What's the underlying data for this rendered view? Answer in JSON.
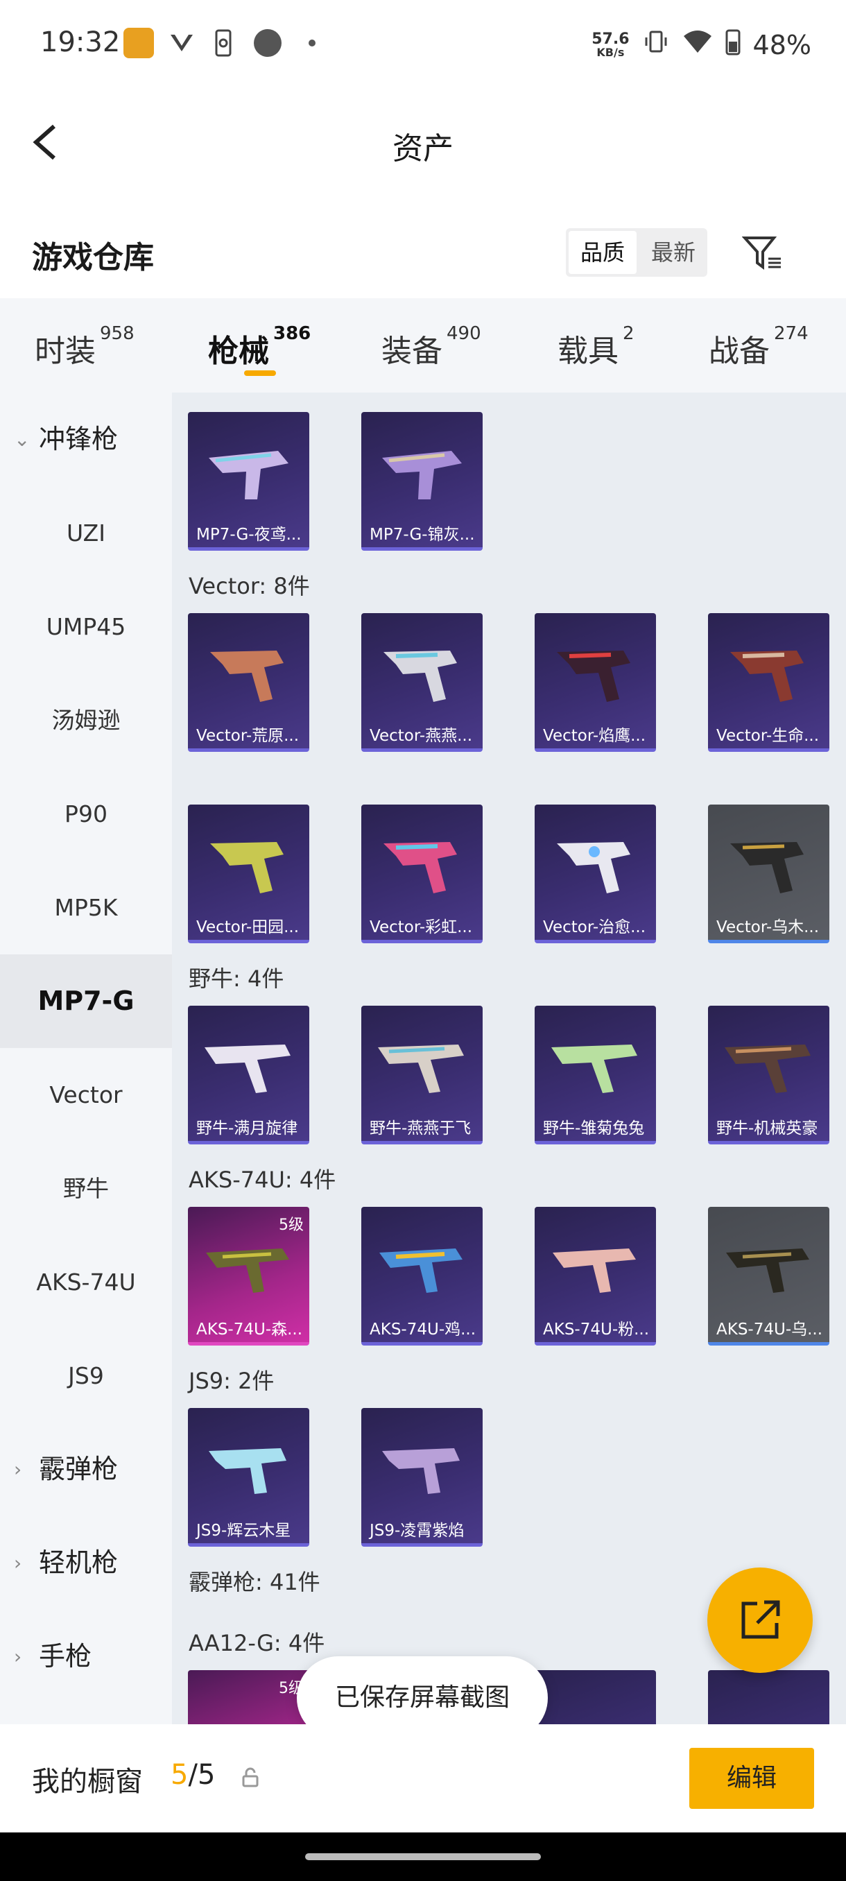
{
  "status": {
    "time": "19:32",
    "speed_value": "57.6",
    "speed_unit": "KB/s",
    "battery": "48%"
  },
  "header": {
    "title": "资产"
  },
  "section": {
    "title": "游戏仓库",
    "sort_quality": "品质",
    "sort_latest": "最新"
  },
  "tabs": [
    {
      "label": "时装",
      "count": "958"
    },
    {
      "label": "枪械",
      "count": "386"
    },
    {
      "label": "装备",
      "count": "490"
    },
    {
      "label": "载具",
      "count": "2"
    },
    {
      "label": "战备",
      "count": "274"
    }
  ],
  "sidebar": {
    "category1": "冲锋枪",
    "items": [
      "UZI",
      "UMP45",
      "汤姆逊",
      "P90",
      "MP5K",
      "MP7-G",
      "Vector",
      "野牛",
      "AKS-74U",
      "JS9"
    ],
    "category2": "霰弹枪",
    "category3": "轻机枪",
    "category4": "手枪"
  },
  "groups": {
    "mp7": {
      "cards": [
        "MP7-G-夜鸢...",
        "MP7-G-锦灰..."
      ]
    },
    "vector": {
      "label": "Vector: 8件",
      "cards": [
        "Vector-荒原...",
        "Vector-燕燕...",
        "Vector-焰鹰...",
        "Vector-生命...",
        "Vector-田园...",
        "Vector-彩虹...",
        "Vector-治愈...",
        "Vector-乌木..."
      ]
    },
    "bison": {
      "label": "野牛: 4件",
      "cards": [
        "野牛-满月旋律",
        "野牛-燕燕于飞",
        "野牛-雏菊兔兔",
        "野牛-机械英豪"
      ]
    },
    "aks": {
      "label": "AKS-74U: 4件",
      "level": "5级",
      "cards": [
        "AKS-74U-森...",
        "AKS-74U-鸡...",
        "AKS-74U-粉...",
        "AKS-74U-乌..."
      ]
    },
    "js9": {
      "label": "JS9: 2件",
      "cards": [
        "JS9-辉云木星",
        "JS9-凌霄紫焰"
      ]
    },
    "shotgun": {
      "label": "霰弹枪: 41件"
    },
    "aa12": {
      "label": "AA12-G: 4件",
      "level": "5级"
    }
  },
  "toast": "已保存屏幕截图",
  "bottom": {
    "label": "我的橱窗",
    "count_current": "5",
    "count_sep": "/",
    "count_total": "5",
    "edit": "编辑"
  },
  "colors": {
    "accent": "#f7b000",
    "card_purple": "#3a2d70",
    "card_gray": "#5b5e65",
    "card_pink": "#cf2fa6"
  }
}
